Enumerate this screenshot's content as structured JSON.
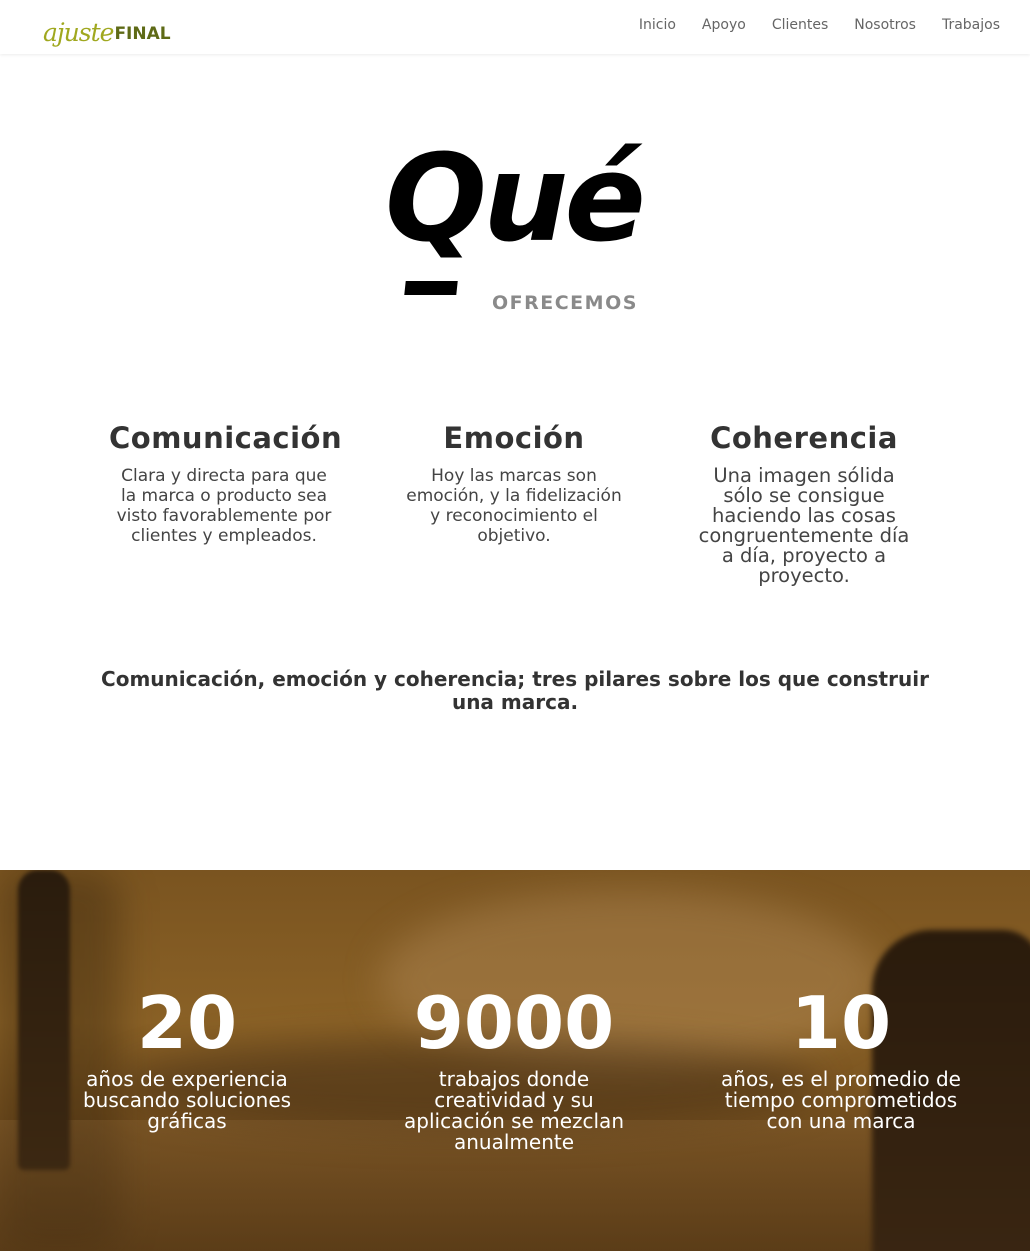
{
  "header": {
    "logo": {
      "part1": "ajuste",
      "part2": "FINAL"
    },
    "nav": [
      "Inicio",
      "Apoyo",
      "Clientes",
      "Nosotros",
      "Trabajos"
    ]
  },
  "hero": {
    "title": "Qué",
    "subtitle": "OFRECEMOS"
  },
  "features": [
    {
      "title": "Comunicación",
      "text": "Clara y directa para que la marca o producto sea visto favorablemente por clientes y empleados."
    },
    {
      "title": "Emoción",
      "text": "Hoy las marcas son emoción, y la fidelización y reconocimiento el objetivo."
    },
    {
      "title": "Coherencia",
      "text": "Una imagen sólida sólo se consigue haciendo las cosas congruentemente día a día, proyecto a proyecto."
    }
  ],
  "tagline": "Comunicación, emoción y coherencia; tres pilares sobre los que construir una marca.",
  "stats": [
    {
      "number": "20",
      "text": "años de experiencia buscando soluciones gráficas"
    },
    {
      "number": "9000",
      "text": "trabajos donde creatividad y su aplicación se mezclan anualmente"
    },
    {
      "number": "10",
      "text": "años, es el promedio de tiempo comprometidos con una marca"
    }
  ],
  "colors": {
    "logo_light": "#a0a81f",
    "logo_dark": "#5e6a16",
    "stats_bg": "#7a5420"
  }
}
